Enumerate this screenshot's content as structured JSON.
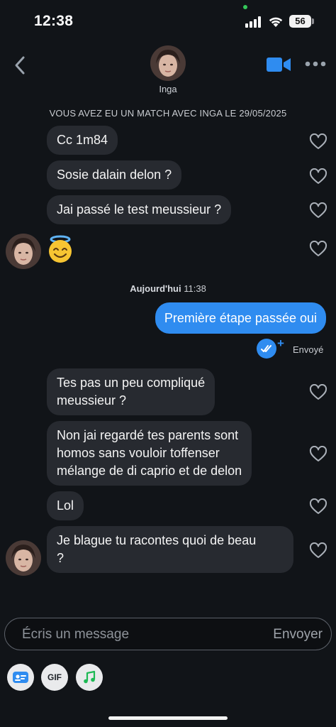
{
  "status_bar": {
    "time": "12:38",
    "battery": "56"
  },
  "header": {
    "contact_name": "Inga"
  },
  "match_notice": "VOUS AVEZ EU UN MATCH AVEC INGA LE 29/05/2025",
  "received_group_1": [
    {
      "text": "Cc 1m84"
    },
    {
      "text": "Sosie dalain delon ?"
    },
    {
      "text": "Jai passé le test meussieur ?"
    },
    {
      "text": "😇"
    }
  ],
  "day_separator": {
    "day": "Aujourd'hui",
    "time": "11:38"
  },
  "sent_message": {
    "text": "Première étape passée oui",
    "status": "Envoyé"
  },
  "received_group_2": [
    {
      "line1": "Tes pas un peu compliqué",
      "line2": "meussieur ?"
    },
    {
      "line1": "Non jai regardé tes parents sont",
      "line2": "homos sans vouloir toffenser",
      "line3": "mélange de di caprio et de delon"
    },
    {
      "line1": "Lol"
    },
    {
      "line1": "Je blague tu racontes quoi de beau",
      "line2": "?"
    }
  ],
  "composer": {
    "placeholder": "Écris un message",
    "send_label": "Envoyer"
  },
  "toolbar": {
    "gif_label": "GIF"
  },
  "icons": {
    "back": "chevron-left-icon",
    "video": "video-camera-icon",
    "more": "more-dots-icon",
    "like": "heart-icon",
    "read": "double-check-icon",
    "profile_card": "profile-card-icon",
    "music": "music-note-icon"
  },
  "colors": {
    "accent": "#2f8cf0",
    "bubble": "#272a30",
    "background": "#111418"
  }
}
